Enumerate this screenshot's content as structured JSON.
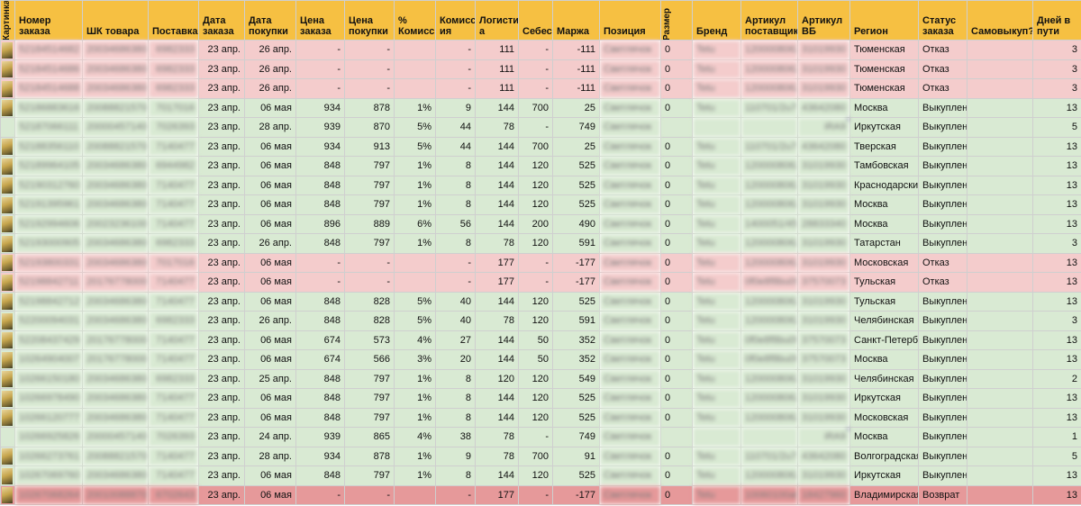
{
  "headers": [
    "Картинка",
    "Номер заказа",
    "ШК товара",
    "Поставка",
    "Дата заказа",
    "Дата покупки",
    "Цена заказа",
    "Цена покупки",
    "% Комиссии",
    "Комисс ия",
    "Логистик а",
    "Себес",
    "Маржа",
    "Позиция",
    "Размер",
    "Бренд",
    "Артикул поставщика",
    "Артикул ВБ",
    "Регион",
    "Статус заказа",
    "Самовыкуп?",
    "Дней в пути"
  ],
  "rows": [
    {
      "order": "52184514682",
      "barcode": "2003468638008",
      "supply": "6982333",
      "order_date": "23 апр.",
      "buy_date": "26 апр.",
      "order_price": "-",
      "buy_price": "-",
      "commission_pct": "",
      "commission": "-",
      "logistics": "111",
      "cost": "-",
      "margin": "-111",
      "position": "Светлячок",
      "size": "0",
      "brand": "Tetu",
      "supplier_sku": "120000806211",
      "wb_sku": "31019930",
      "region": "Тюменская",
      "status": "Отказ",
      "self_buy": "",
      "days": "3",
      "tone": "refuse",
      "has_img": true
    },
    {
      "order": "52184514686",
      "barcode": "2003468638008",
      "supply": "6982333",
      "order_date": "23 апр.",
      "buy_date": "26 апр.",
      "order_price": "-",
      "buy_price": "-",
      "commission_pct": "",
      "commission": "-",
      "logistics": "111",
      "cost": "-",
      "margin": "-111",
      "position": "Светлячок",
      "size": "0",
      "brand": "Tetu",
      "supplier_sku": "120000806211",
      "wb_sku": "31019930",
      "region": "Тюменская",
      "status": "Отказ",
      "self_buy": "",
      "days": "3",
      "tone": "refuse",
      "has_img": true
    },
    {
      "order": "52184514688",
      "barcode": "2003468638008",
      "supply": "6982333",
      "order_date": "23 апр.",
      "buy_date": "26 апр.",
      "order_price": "-",
      "buy_price": "-",
      "commission_pct": "",
      "commission": "-",
      "logistics": "111",
      "cost": "-",
      "margin": "-111",
      "position": "Светлячок",
      "size": "0",
      "brand": "Tetu",
      "supplier_sku": "120000806211",
      "wb_sku": "31019930",
      "region": "Тюменская",
      "status": "Отказ",
      "self_buy": "",
      "days": "3",
      "tone": "refuse",
      "has_img": true
    },
    {
      "order": "52186883616",
      "barcode": "2008882157004",
      "supply": "7017016",
      "order_date": "23 апр.",
      "buy_date": "06 мая",
      "order_price": "934",
      "buy_price": "878",
      "commission_pct": "1%",
      "commission": "9",
      "logistics": "144",
      "cost": "700",
      "margin": "25",
      "position": "Светлячок",
      "size": "0",
      "brand": "Tetu",
      "supplier_sku": "110701/2u70",
      "wb_sku": "43642080",
      "region": "Москва",
      "status": "Выкуплен",
      "self_buy": "",
      "days": "13",
      "tone": "buy",
      "has_img": true
    },
    {
      "order": "52187066111",
      "barcode": "2000045714007",
      "supply": "7026393",
      "order_date": "23 апр.",
      "buy_date": "28 апр.",
      "order_price": "939",
      "buy_price": "870",
      "commission_pct": "5%",
      "commission": "44",
      "logistics": "78",
      "cost": "-",
      "margin": "749",
      "position": "Светлячок",
      "size": "",
      "brand": "",
      "supplier_sku": "",
      "wb_sku": "iRA9",
      "region": "Иркутская",
      "status": "Выкуплен",
      "self_buy": "",
      "days": "5",
      "tone": "buy",
      "has_img": false
    },
    {
      "order": "52188356110",
      "barcode": "2008882157004",
      "supply": "7140477",
      "order_date": "23 апр.",
      "buy_date": "06 мая",
      "order_price": "934",
      "buy_price": "913",
      "commission_pct": "5%",
      "commission": "44",
      "logistics": "144",
      "cost": "700",
      "margin": "25",
      "position": "Светлячок",
      "size": "0",
      "brand": "Tetu",
      "supplier_sku": "110701/2u70",
      "wb_sku": "43642080",
      "region": "Тверская",
      "status": "Выкуплен",
      "self_buy": "",
      "days": "13",
      "tone": "buy",
      "has_img": true
    },
    {
      "order": "52189964105",
      "barcode": "2003468638008",
      "supply": "6944982",
      "order_date": "23 апр.",
      "buy_date": "06 мая",
      "order_price": "848",
      "buy_price": "797",
      "commission_pct": "1%",
      "commission": "8",
      "logistics": "144",
      "cost": "120",
      "margin": "525",
      "position": "Светлячок",
      "size": "0",
      "brand": "Tetu",
      "supplier_sku": "120000806211",
      "wb_sku": "31019930",
      "region": "Тамбовская",
      "status": "Выкуплен",
      "self_buy": "",
      "days": "13",
      "tone": "buy",
      "has_img": true
    },
    {
      "order": "52190312760",
      "barcode": "2003468638008",
      "supply": "7140477",
      "order_date": "23 апр.",
      "buy_date": "06 мая",
      "order_price": "848",
      "buy_price": "797",
      "commission_pct": "1%",
      "commission": "8",
      "logistics": "144",
      "cost": "120",
      "margin": "525",
      "position": "Светлячок",
      "size": "0",
      "brand": "Tetu",
      "supplier_sku": "120000806211",
      "wb_sku": "31019930",
      "region": "Краснодарский",
      "status": "Выкуплен",
      "self_buy": "",
      "days": "13",
      "tone": "buy",
      "has_img": true
    },
    {
      "order": "52191395961",
      "barcode": "2003468638008",
      "supply": "7140477",
      "order_date": "23 апр.",
      "buy_date": "06 мая",
      "order_price": "848",
      "buy_price": "797",
      "commission_pct": "1%",
      "commission": "8",
      "logistics": "144",
      "cost": "120",
      "margin": "525",
      "position": "Светлячок",
      "size": "0",
      "brand": "Tetu",
      "supplier_sku": "120000806211",
      "wb_sku": "31019930",
      "region": "Москва",
      "status": "Выкуплен",
      "self_buy": "",
      "days": "13",
      "tone": "buy",
      "has_img": true
    },
    {
      "order": "52192994606",
      "barcode": "2002323610005",
      "supply": "7140477",
      "order_date": "23 апр.",
      "buy_date": "06 мая",
      "order_price": "896",
      "buy_price": "889",
      "commission_pct": "6%",
      "commission": "56",
      "logistics": "144",
      "cost": "200",
      "margin": "490",
      "position": "Светлячок",
      "size": "0",
      "brand": "Tetu",
      "supplier_sku": "1400051/45a6",
      "wb_sku": "28833340",
      "region": "Москва",
      "status": "Выкуплен",
      "self_buy": "",
      "days": "13",
      "tone": "buy",
      "has_img": true
    },
    {
      "order": "52193000905",
      "barcode": "2003468638008",
      "supply": "6982333",
      "order_date": "23 апр.",
      "buy_date": "26 апр.",
      "order_price": "848",
      "buy_price": "797",
      "commission_pct": "1%",
      "commission": "8",
      "logistics": "78",
      "cost": "120",
      "margin": "591",
      "position": "Светлячок",
      "size": "0",
      "brand": "Tetu",
      "supplier_sku": "120000806211",
      "wb_sku": "31019930",
      "region": "Татарстан",
      "status": "Выкуплен",
      "self_buy": "",
      "days": "3",
      "tone": "buy",
      "has_img": true
    },
    {
      "order": "52193800331",
      "barcode": "2003468638008",
      "supply": "7017016",
      "order_date": "23 апр.",
      "buy_date": "06 мая",
      "order_price": "-",
      "buy_price": "-",
      "commission_pct": "",
      "commission": "-",
      "logistics": "177",
      "cost": "-",
      "margin": "-177",
      "position": "Светлячок",
      "size": "0",
      "brand": "Tetu",
      "supplier_sku": "120000806211",
      "wb_sku": "31019930",
      "region": "Московская",
      "status": "Отказ",
      "self_buy": "",
      "days": "13",
      "tone": "refuse",
      "has_img": true
    },
    {
      "order": "52198842711",
      "barcode": "2017677800000",
      "supply": "7140477",
      "order_date": "23 апр.",
      "buy_date": "06 мая",
      "order_price": "-",
      "buy_price": "-",
      "commission_pct": "",
      "commission": "-",
      "logistics": "177",
      "cost": "-",
      "margin": "-177",
      "position": "Светлячок",
      "size": "0",
      "brand": "Tetu",
      "supplier_sku": "0f0e8f8bu09",
      "wb_sku": "37570073",
      "region": "Тульская",
      "status": "Отказ",
      "self_buy": "",
      "days": "13",
      "tone": "refuse",
      "has_img": true
    },
    {
      "order": "52198842712",
      "barcode": "2003468638008",
      "supply": "7140477",
      "order_date": "23 апр.",
      "buy_date": "06 мая",
      "order_price": "848",
      "buy_price": "828",
      "commission_pct": "5%",
      "commission": "40",
      "logistics": "144",
      "cost": "120",
      "margin": "525",
      "position": "Светлячок",
      "size": "0",
      "brand": "Tetu",
      "supplier_sku": "120000806211",
      "wb_sku": "31019930",
      "region": "Тульская",
      "status": "Выкуплен",
      "self_buy": "",
      "days": "13",
      "tone": "buy",
      "has_img": true
    },
    {
      "order": "52200094031",
      "barcode": "2003468638008",
      "supply": "6982333",
      "order_date": "23 апр.",
      "buy_date": "26 апр.",
      "order_price": "848",
      "buy_price": "828",
      "commission_pct": "5%",
      "commission": "40",
      "logistics": "78",
      "cost": "120",
      "margin": "591",
      "position": "Светлячок",
      "size": "0",
      "brand": "Tetu",
      "supplier_sku": "120000806211",
      "wb_sku": "31019930",
      "region": "Челябинская",
      "status": "Выкуплен",
      "self_buy": "",
      "days": "3",
      "tone": "buy",
      "has_img": true
    },
    {
      "order": "52208437429",
      "barcode": "2017677800000",
      "supply": "7140477",
      "order_date": "23 апр.",
      "buy_date": "06 мая",
      "order_price": "674",
      "buy_price": "573",
      "commission_pct": "4%",
      "commission": "27",
      "logistics": "144",
      "cost": "50",
      "margin": "352",
      "position": "Светлячок",
      "size": "0",
      "brand": "Tetu",
      "supplier_sku": "0f0e8f8bu09",
      "wb_sku": "37570073",
      "region": "Санкт-Петербург",
      "status": "Выкуплен",
      "self_buy": "",
      "days": "13",
      "tone": "buy",
      "has_img": true
    },
    {
      "order": "10264904007",
      "barcode": "2017677800000",
      "supply": "7140477",
      "order_date": "23 апр.",
      "buy_date": "06 мая",
      "order_price": "674",
      "buy_price": "566",
      "commission_pct": "3%",
      "commission": "20",
      "logistics": "144",
      "cost": "50",
      "margin": "352",
      "position": "Светлячок",
      "size": "0",
      "brand": "Tetu",
      "supplier_sku": "0f0e8f8bu09",
      "wb_sku": "37570073",
      "region": "Москва",
      "status": "Выкуплен",
      "self_buy": "",
      "days": "13",
      "tone": "buy",
      "has_img": true
    },
    {
      "order": "10266150180",
      "barcode": "2003468638008",
      "supply": "6982333",
      "order_date": "23 апр.",
      "buy_date": "25 апр.",
      "order_price": "848",
      "buy_price": "797",
      "commission_pct": "1%",
      "commission": "8",
      "logistics": "120",
      "cost": "120",
      "margin": "549",
      "position": "Светлячок",
      "size": "0",
      "brand": "Tetu",
      "supplier_sku": "120000806211",
      "wb_sku": "31019930",
      "region": "Челябинская",
      "status": "Выкуплен",
      "self_buy": "",
      "days": "2",
      "tone": "buy",
      "has_img": true
    },
    {
      "order": "10266978490",
      "barcode": "2003468638008",
      "supply": "7140477",
      "order_date": "23 апр.",
      "buy_date": "06 мая",
      "order_price": "848",
      "buy_price": "797",
      "commission_pct": "1%",
      "commission": "8",
      "logistics": "144",
      "cost": "120",
      "margin": "525",
      "position": "Светлячок",
      "size": "0",
      "brand": "Tetu",
      "supplier_sku": "120000806211",
      "wb_sku": "31019930",
      "region": "Иркутская",
      "status": "Выкуплен",
      "self_buy": "",
      "days": "13",
      "tone": "buy",
      "has_img": true
    },
    {
      "order": "10266120777",
      "barcode": "2003468638008",
      "supply": "7140477",
      "order_date": "23 апр.",
      "buy_date": "06 мая",
      "order_price": "848",
      "buy_price": "797",
      "commission_pct": "1%",
      "commission": "8",
      "logistics": "144",
      "cost": "120",
      "margin": "525",
      "position": "Светлячок",
      "size": "0",
      "brand": "Tetu",
      "supplier_sku": "120000806211",
      "wb_sku": "31019930",
      "region": "Московская",
      "status": "Выкуплен",
      "self_buy": "",
      "days": "13",
      "tone": "buy",
      "has_img": true
    },
    {
      "order": "10266925826",
      "barcode": "2000045714007",
      "supply": "7026393",
      "order_date": "23 апр.",
      "buy_date": "24 апр.",
      "order_price": "939",
      "buy_price": "865",
      "commission_pct": "4%",
      "commission": "38",
      "logistics": "78",
      "cost": "-",
      "margin": "749",
      "position": "Светлячок",
      "size": "",
      "brand": "",
      "supplier_sku": "",
      "wb_sku": "iRA9",
      "region": "Москва",
      "status": "Выкуплен",
      "self_buy": "",
      "days": "1",
      "tone": "buy",
      "has_img": false
    },
    {
      "order": "10266273761",
      "barcode": "2008882157004",
      "supply": "7140477",
      "order_date": "23 апр.",
      "buy_date": "28 апр.",
      "order_price": "934",
      "buy_price": "878",
      "commission_pct": "1%",
      "commission": "9",
      "logistics": "78",
      "cost": "700",
      "margin": "91",
      "position": "Светлячок",
      "size": "0",
      "brand": "Tetu",
      "supplier_sku": "110701/2u70",
      "wb_sku": "43642080",
      "region": "Волгоградская",
      "status": "Выкуплен",
      "self_buy": "",
      "days": "5",
      "tone": "buy",
      "has_img": true
    },
    {
      "order": "10267069760",
      "barcode": "2003468638008",
      "supply": "7140477",
      "order_date": "23 апр.",
      "buy_date": "06 мая",
      "order_price": "848",
      "buy_price": "797",
      "commission_pct": "1%",
      "commission": "8",
      "logistics": "144",
      "cost": "120",
      "margin": "525",
      "position": "Светлячок",
      "size": "0",
      "brand": "Tetu",
      "supplier_sku": "120000806211",
      "wb_sku": "31019930",
      "region": "Иркутская",
      "status": "Выкуплен",
      "self_buy": "",
      "days": "13",
      "tone": "buy",
      "has_img": true
    },
    {
      "order": "10267068264",
      "barcode": "2001008887000",
      "supply": "6702643",
      "order_date": "23 апр.",
      "buy_date": "06 мая",
      "order_price": "-",
      "buy_price": "-",
      "commission_pct": "",
      "commission": "-",
      "logistics": "177",
      "cost": "-",
      "margin": "-177",
      "position": "Светлячок",
      "size": "0",
      "brand": "Tetu",
      "supplier_sku": "10060100a60",
      "wb_sku": "18427960",
      "region": "Владимирская",
      "status": "Возврат",
      "self_buy": "",
      "days": "13",
      "tone": "return",
      "has_img": true
    }
  ]
}
